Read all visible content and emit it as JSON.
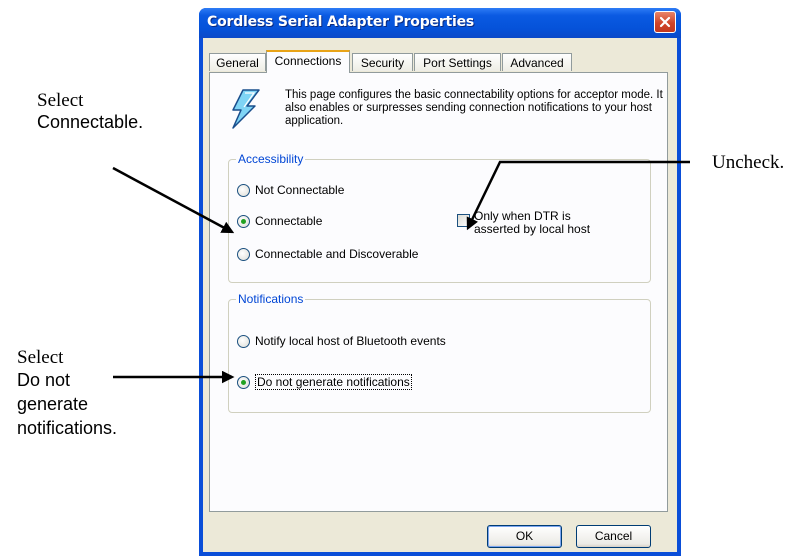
{
  "window": {
    "title": "Cordless Serial Adapter Properties"
  },
  "tabs": [
    {
      "label": "General",
      "active": false
    },
    {
      "label": "Connections",
      "active": true
    },
    {
      "label": "Security",
      "active": false
    },
    {
      "label": "Port Settings",
      "active": false
    },
    {
      "label": "Advanced",
      "active": false
    }
  ],
  "description": "This page configures the basic connectability options for acceptor mode. It also enables or surpresses sending connection notifications to your host application.",
  "accessibility": {
    "legend": "Accessibility",
    "options": [
      {
        "label": "Not Connectable",
        "selected": false
      },
      {
        "label": "Connectable",
        "selected": true
      },
      {
        "label": "Connectable and Discoverable",
        "selected": false
      }
    ],
    "dtr_checkbox": {
      "label_line1": "Only when DTR is",
      "label_line2": "asserted by local host",
      "checked": false
    }
  },
  "notifications": {
    "legend": "Notifications",
    "options": [
      {
        "label": "Notify local host of Bluetooth events",
        "selected": false
      },
      {
        "label": "Do not generate notifications",
        "selected": true
      }
    ]
  },
  "buttons": {
    "ok": "OK",
    "cancel": "Cancel"
  },
  "annotations": {
    "select_connectable_1": "Select",
    "select_connectable_2": "Connectable.",
    "uncheck": "Uncheck.",
    "select_notify_1": "Select",
    "select_notify_2": "Do not",
    "select_notify_3": "generate",
    "select_notify_4": "notifications."
  },
  "icons": {
    "close": "close-icon",
    "lightning": "lightning-icon"
  },
  "colors": {
    "titlebar": "#0552d9",
    "dialog_bg": "#ece9d8",
    "group_label": "#0046d5",
    "radio_dot": "#21a121",
    "close_button": "#d1452a"
  }
}
